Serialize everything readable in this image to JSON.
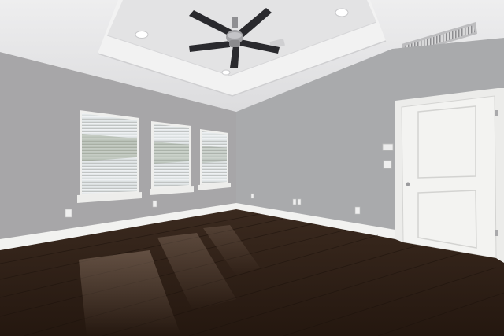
{
  "scene": {
    "subject": "empty-bedroom",
    "elements": [
      "tray-ceiling",
      "ceiling-fan",
      "recessed-lights",
      "hvac-vent",
      "three-windows-with-blinds",
      "white-door",
      "thermostat",
      "light-switch",
      "electrical-outlets",
      "baseboards",
      "dark-hardwood-floor"
    ]
  },
  "colors": {
    "wall_left": "#a7a6a8",
    "wall_back": "#a9aaac",
    "wall_right": "#a4a5a8",
    "ceiling": "#e9e9ea",
    "tray": "#f0f0f0",
    "trim": "#f4f4f2",
    "door": "#f3f3f1",
    "floor_dark": "#2c1d14",
    "floor_mid": "#4a3324",
    "floor_light": "#7a6253",
    "fan_blade": "#2a2a2e",
    "fan_metal": "#9a9a9c",
    "vent": "#d9d9d9",
    "window_sky": "#eef2f6",
    "window_tree": "#7a8a6e"
  }
}
